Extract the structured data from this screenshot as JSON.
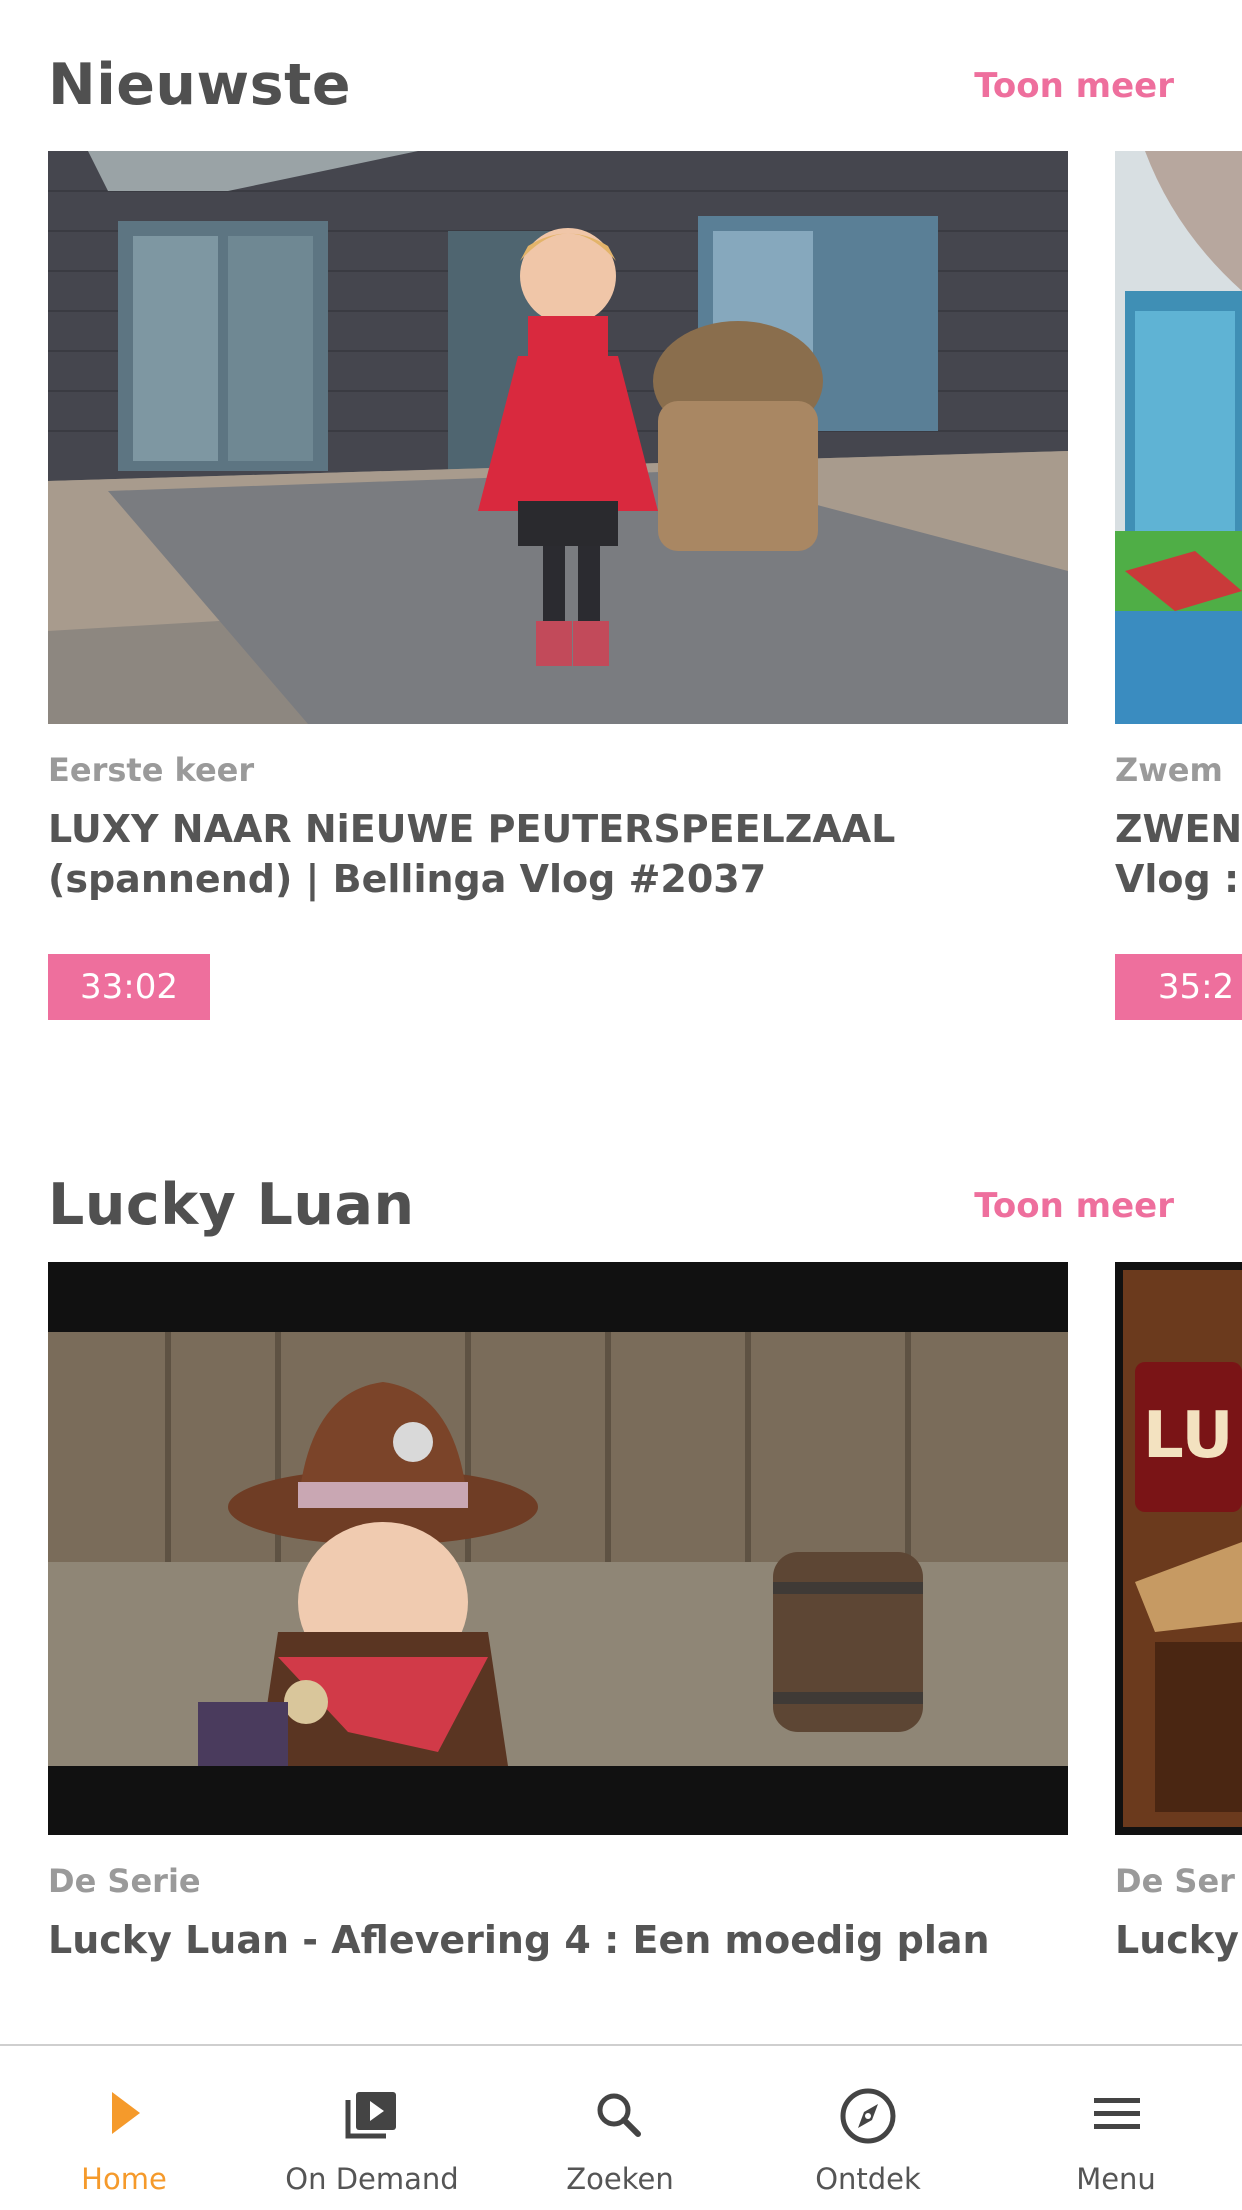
{
  "sections": [
    {
      "title": "Nieuwste",
      "show_more": "Toon meer",
      "cards": [
        {
          "kicker": "Eerste keer",
          "title_line1": "LUXY NAAR NiEUWE PEUTERSPEELZAAL",
          "title_line2": "(spannend) | Bellinga Vlog #2037",
          "duration": "33:02"
        },
        {
          "kicker": "Zwem",
          "title_line1": "ZWEN",
          "title_line2": "Vlog :",
          "duration": "35:2"
        }
      ]
    },
    {
      "title": "Lucky Luan",
      "show_more": "Toon meer",
      "cards": [
        {
          "kicker": "De Serie",
          "title_line1": "Lucky Luan - Aflevering 4 : Een moedig plan"
        },
        {
          "kicker": "De Ser",
          "title_line1": "Lucky"
        }
      ]
    }
  ],
  "tabbar": {
    "active_color": "#f59a2b",
    "tabs": [
      {
        "label": "Home",
        "icon": "play-icon",
        "active": true
      },
      {
        "label": "On Demand",
        "icon": "video-library-icon",
        "active": false
      },
      {
        "label": "Zoeken",
        "icon": "search-icon",
        "active": false
      },
      {
        "label": "Ontdek",
        "icon": "compass-icon",
        "active": false
      },
      {
        "label": "Menu",
        "icon": "hamburger-menu-icon",
        "active": false
      }
    ]
  },
  "colors": {
    "accent": "#ee6f9d",
    "text": "#505050",
    "muted": "#9a9a9a"
  }
}
